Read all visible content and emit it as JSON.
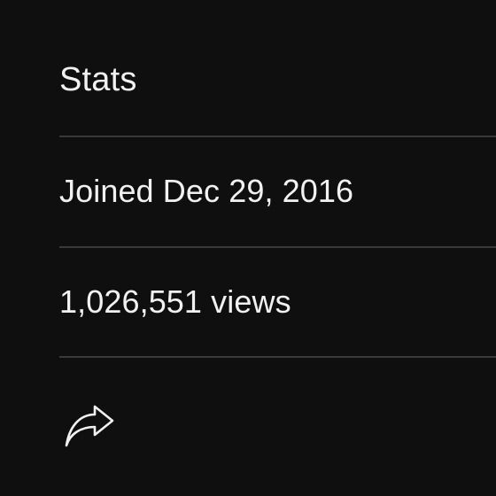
{
  "stats": {
    "title": "Stats",
    "joined": "Joined Dec 29, 2016",
    "views": "1,026,551 views"
  },
  "actions": {
    "share_icon": "share-icon"
  },
  "colors": {
    "background": "#0f0f0f",
    "text": "#f1f1f1",
    "divider": "#3a3a3a"
  }
}
